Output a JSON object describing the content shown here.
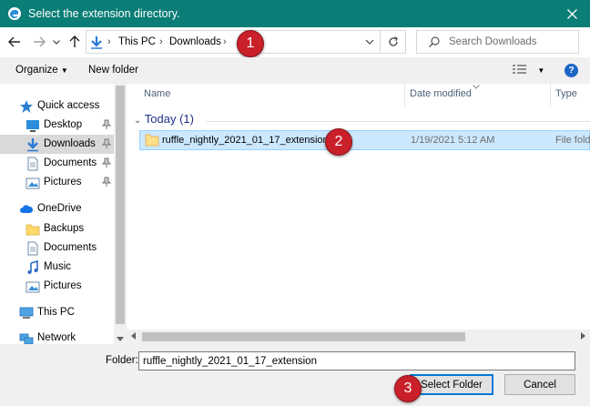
{
  "window": {
    "title": "Select the extension directory.",
    "accent_color": "#0a7d76"
  },
  "navigation": {
    "breadcrumbs": [
      "This PC",
      "Downloads"
    ],
    "search_placeholder": "Search Downloads"
  },
  "toolbar": {
    "organize_label": "Organize",
    "new_folder_label": "New folder",
    "help_label": "?"
  },
  "sidebar": {
    "items": [
      {
        "label": "Quick access",
        "icon": "star-icon",
        "pinned": false,
        "selected": false
      },
      {
        "label": "Desktop",
        "icon": "desktop-icon",
        "pinned": true,
        "selected": false
      },
      {
        "label": "Downloads",
        "icon": "download-icon",
        "pinned": true,
        "selected": true
      },
      {
        "label": "Documents",
        "icon": "document-icon",
        "pinned": true,
        "selected": false
      },
      {
        "label": "Pictures",
        "icon": "pictures-icon",
        "pinned": true,
        "selected": false
      },
      {
        "label": "OneDrive",
        "icon": "cloud-icon",
        "pinned": false,
        "selected": false
      },
      {
        "label": "Backups",
        "icon": "folder-icon",
        "pinned": false,
        "selected": false
      },
      {
        "label": "Documents",
        "icon": "document-icon",
        "pinned": false,
        "selected": false
      },
      {
        "label": "Music",
        "icon": "music-icon",
        "pinned": false,
        "selected": false
      },
      {
        "label": "Pictures",
        "icon": "pictures-icon",
        "pinned": false,
        "selected": false
      },
      {
        "label": "This PC",
        "icon": "computer-icon",
        "pinned": false,
        "selected": false
      },
      {
        "label": "Network",
        "icon": "network-icon",
        "pinned": false,
        "selected": false
      }
    ]
  },
  "file_list": {
    "columns": [
      "Name",
      "Date modified",
      "Type"
    ],
    "group_label": "Today (1)",
    "rows": [
      {
        "name": "ruffle_nightly_2021_01_17_extension",
        "date": "1/19/2021 5:12 AM",
        "type": "File folder"
      }
    ],
    "selection_color": "#cce8ff"
  },
  "footer": {
    "folder_label": "Folder:",
    "folder_value": "ruffle_nightly_2021_01_17_extension",
    "select_button": "Select Folder",
    "cancel_button": "Cancel"
  },
  "annotations": [
    "1",
    "2",
    "3"
  ],
  "annotation_color": "#c9202a"
}
